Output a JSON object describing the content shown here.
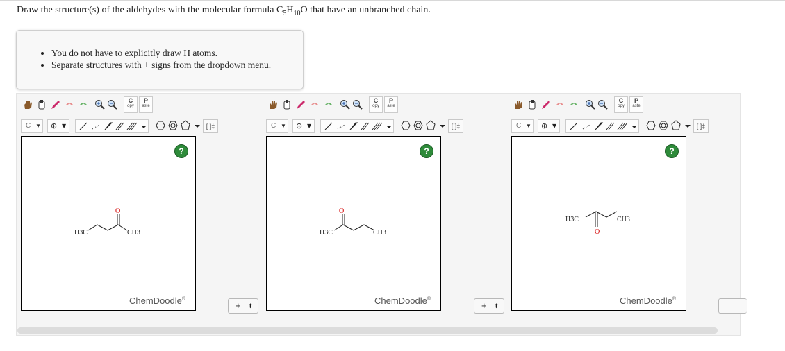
{
  "question": {
    "prefix": "Draw the structure(s) of the aldehydes with the molecular formula C",
    "sub1": "5",
    "mid1": "H",
    "sub2": "10",
    "suffix": "O that have an unbranched chain."
  },
  "hints": [
    "You do not have to explicitly draw H atoms.",
    "Separate structures with + signs from the dropdown menu."
  ],
  "toolbar": {
    "copy_label_top": "C",
    "copy_label_bottom": "opy",
    "paste_label_top": "P",
    "paste_label_bottom": "aste",
    "element_label": "C",
    "bracket_label": "[ ]‡"
  },
  "editors": [
    {
      "help": "?",
      "brand": "ChemDoodle",
      "brand_mark": "®",
      "labels": {
        "o": "O",
        "left": "H3C",
        "right": "CH3"
      }
    },
    {
      "help": "?",
      "brand": "ChemDoodle",
      "brand_mark": "®",
      "labels": {
        "o": "O",
        "left": "H3C",
        "right": "CH3"
      }
    },
    {
      "help": "?",
      "brand": "ChemDoodle",
      "brand_mark": "®",
      "labels": {
        "o": "O",
        "left": "H3C",
        "right": "CH3"
      }
    }
  ],
  "separators": [
    {
      "label": "+",
      "arrows": "⬍"
    },
    {
      "label": "+",
      "arrows": "⬍"
    }
  ],
  "icons": {
    "hand": "hand-icon",
    "eraser_lasso": "lasso-icon",
    "pencil": "pencil-icon",
    "undo": "undo-icon",
    "redo": "redo-icon",
    "zoom_in": "zoom-in-icon",
    "zoom_out": "zoom-out-icon"
  },
  "colors": {
    "help_green": "#2e8b3a",
    "oxygen_red": "#d40000",
    "undo_pink": "#e89090",
    "redo_green": "#6ab46a"
  }
}
